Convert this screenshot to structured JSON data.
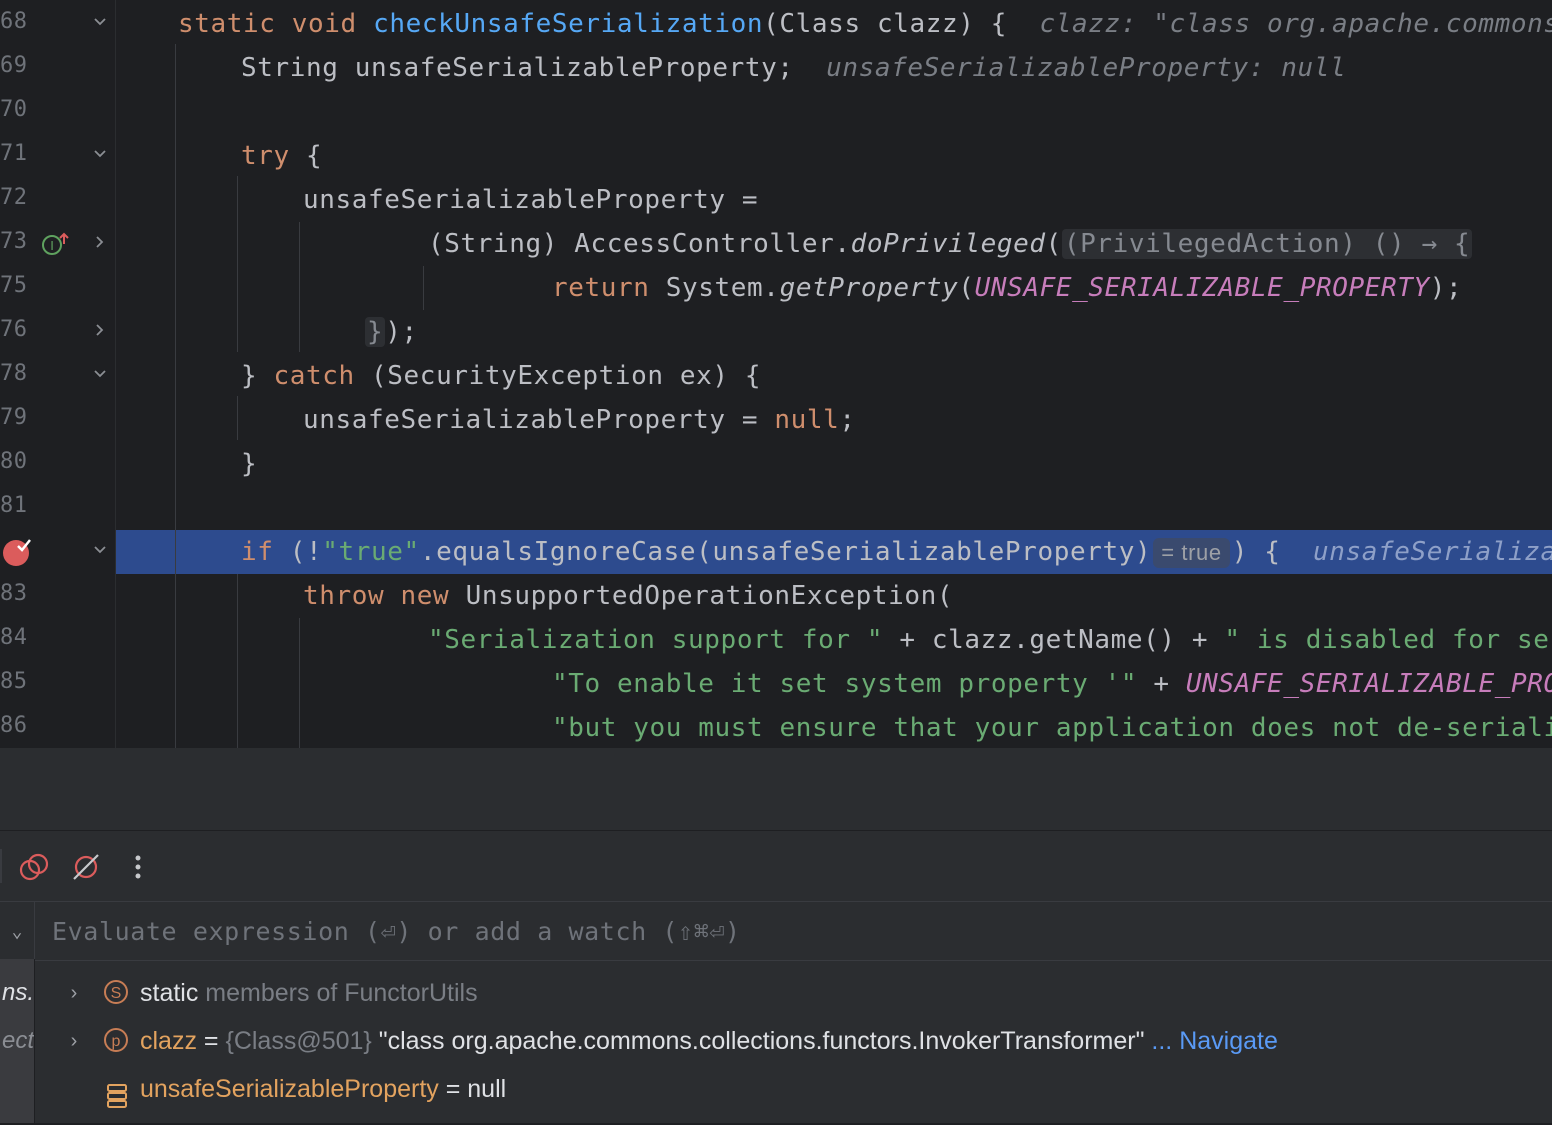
{
  "editor": {
    "lines": [
      {
        "num": "68",
        "fold": "v"
      },
      {
        "num": "69",
        "fold": ""
      },
      {
        "num": "70",
        "fold": ""
      },
      {
        "num": "71",
        "fold": "v"
      },
      {
        "num": "72",
        "fold": ""
      },
      {
        "num": "73",
        "fold": ">"
      },
      {
        "num": "75",
        "fold": ""
      },
      {
        "num": "76",
        "fold": ">"
      },
      {
        "num": "78",
        "fold": "v"
      },
      {
        "num": "79",
        "fold": ""
      },
      {
        "num": "80",
        "fold": ""
      },
      {
        "num": "81",
        "fold": ""
      },
      {
        "num": "",
        "fold": "v"
      },
      {
        "num": "83",
        "fold": ""
      },
      {
        "num": "84",
        "fold": ""
      },
      {
        "num": "85",
        "fold": ""
      },
      {
        "num": "86",
        "fold": ""
      }
    ],
    "code": {
      "l68_static": "static",
      "l68_void": "void",
      "l68_method": "checkUnsafeSerialization",
      "l68_sig": "(Class clazz) {",
      "l68_hint": "clazz: \"class org.apache.commons.co",
      "l69_text": "String unsafeSerializableProperty;",
      "l69_hint": "unsafeSerializableProperty: null",
      "l71_try": "try",
      "l71_brace": " {",
      "l72_text": "unsafeSerializableProperty =",
      "l73_cast": "(String) AccessController.",
      "l73_method": "doPrivileged",
      "l73_paren": "(",
      "l73_inlay": "(PrivilegedAction) () → {",
      "l75_return": "return",
      "l75_sys": " System.",
      "l75_method": "getProperty",
      "l75_open": "(",
      "l75_const": "UNSAFE_SERIALIZABLE_PROPERTY",
      "l75_close": ");",
      "l76_brace": "}",
      "l76_rest": ");",
      "l78_close": "} ",
      "l78_catch": "catch",
      "l78_rest": " (SecurityException ex) {",
      "l79_text": "unsafeSerializableProperty = ",
      "l79_null": "null",
      "l79_semi": ";",
      "l80_text": "}",
      "l82_if": "if",
      "l82_a": " (!",
      "l82_str": "\"true\"",
      "l82_b": ".equalsIgnoreCase(unsafeSerializableProperty)",
      "l82_eval": "= true",
      "l82_c": ") {",
      "l82_hint": "unsafeSerializabl",
      "l83_throw": "throw",
      "l83_new": "new",
      "l83_rest": " UnsupportedOperationException(",
      "l84_str1": "\"Serialization support for \"",
      "l84_mid": " + clazz.getName() + ",
      "l84_str2": "\" is disabled for secur",
      "l85_str": "\"To enable it set system property '\"",
      "l85_plus": " + ",
      "l85_const": "UNSAFE_SERIALIZABLE_PROPE",
      "l86_str": "\"but you must ensure that your application does not de-serialize"
    }
  },
  "debug": {
    "eval_placeholder": "Evaluate expression (⏎) or add a watch (⇧⌘⏎)",
    "frames": [
      {
        "label": "ns."
      },
      {
        "label": "ect"
      }
    ],
    "vars": [
      {
        "icon": "S",
        "name": "static",
        "rest": " members of FunctorUtils"
      },
      {
        "icon": "p",
        "name": "clazz",
        "eq": " = ",
        "type": "{Class@501}",
        "value": " \"class org.apache.commons.collections.functors.InvokerTransformer\"",
        "link": " ... Navigate"
      },
      {
        "name": "unsafeSerializableProperty",
        "eq": " = ",
        "value": "null"
      }
    ]
  },
  "colors": {
    "background": "#1e1f22",
    "current_line": "#2d4b8e",
    "keyword": "#cf8e6d",
    "string": "#6aab73",
    "method": "#56a8f5",
    "constant": "#c77dbb",
    "breakpoint": "#db5c5c"
  },
  "icons": [
    "fold-chevron-icon",
    "implementation-icon",
    "breakpoint-icon",
    "mute-breakpoints-icon",
    "view-breakpoints-icon",
    "more-icon",
    "static-icon",
    "parameter-icon",
    "field-icon"
  ]
}
